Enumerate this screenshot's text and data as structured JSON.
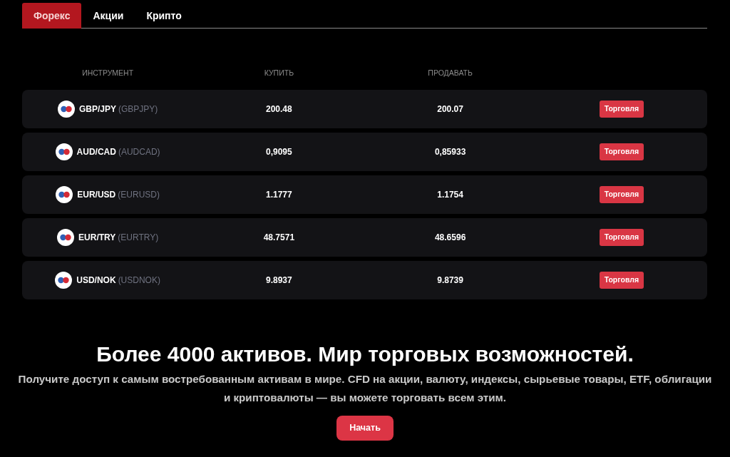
{
  "tabs": [
    {
      "label": "Форекс",
      "selected": true
    },
    {
      "label": "Акции",
      "selected": false
    },
    {
      "label": "Крипто",
      "selected": false
    }
  ],
  "table": {
    "columns": [
      "ИНСТРУМЕНТ",
      "КУПИТЬ",
      "ПРОДАВАТЬ"
    ],
    "rows": [
      {
        "pair": "GBP/JPY",
        "symbol": "(GBPJPY)",
        "buy": "200.48",
        "sell": "200.07",
        "action": "Торговля"
      },
      {
        "pair": "AUD/CAD",
        "symbol": "(AUDCAD)",
        "buy": "0,9095",
        "sell": "0,85933",
        "action": "Торговля"
      },
      {
        "pair": "EUR/USD",
        "symbol": "(EURUSD)",
        "buy": "1.1777",
        "sell": "1.1754",
        "action": "Торговля"
      },
      {
        "pair": "EUR/TRY",
        "symbol": "(EURTRY)",
        "buy": "48.7571",
        "sell": "48.6596",
        "action": "Торговля"
      },
      {
        "pair": "USD/NOK",
        "symbol": "(USDNOK)",
        "buy": "9.8937",
        "sell": "9.8739",
        "action": "Торговля"
      }
    ]
  },
  "promo": {
    "title": "Более 4000 активов. Мир торговых возможностей.",
    "text": "Получите доступ к самым востребованным активам в мире. CFD на акции, валюту, индексы, сырьевые товары, ETF, облигации и криптовалюты — вы можете торговать всем этим.",
    "button": "Начать"
  }
}
